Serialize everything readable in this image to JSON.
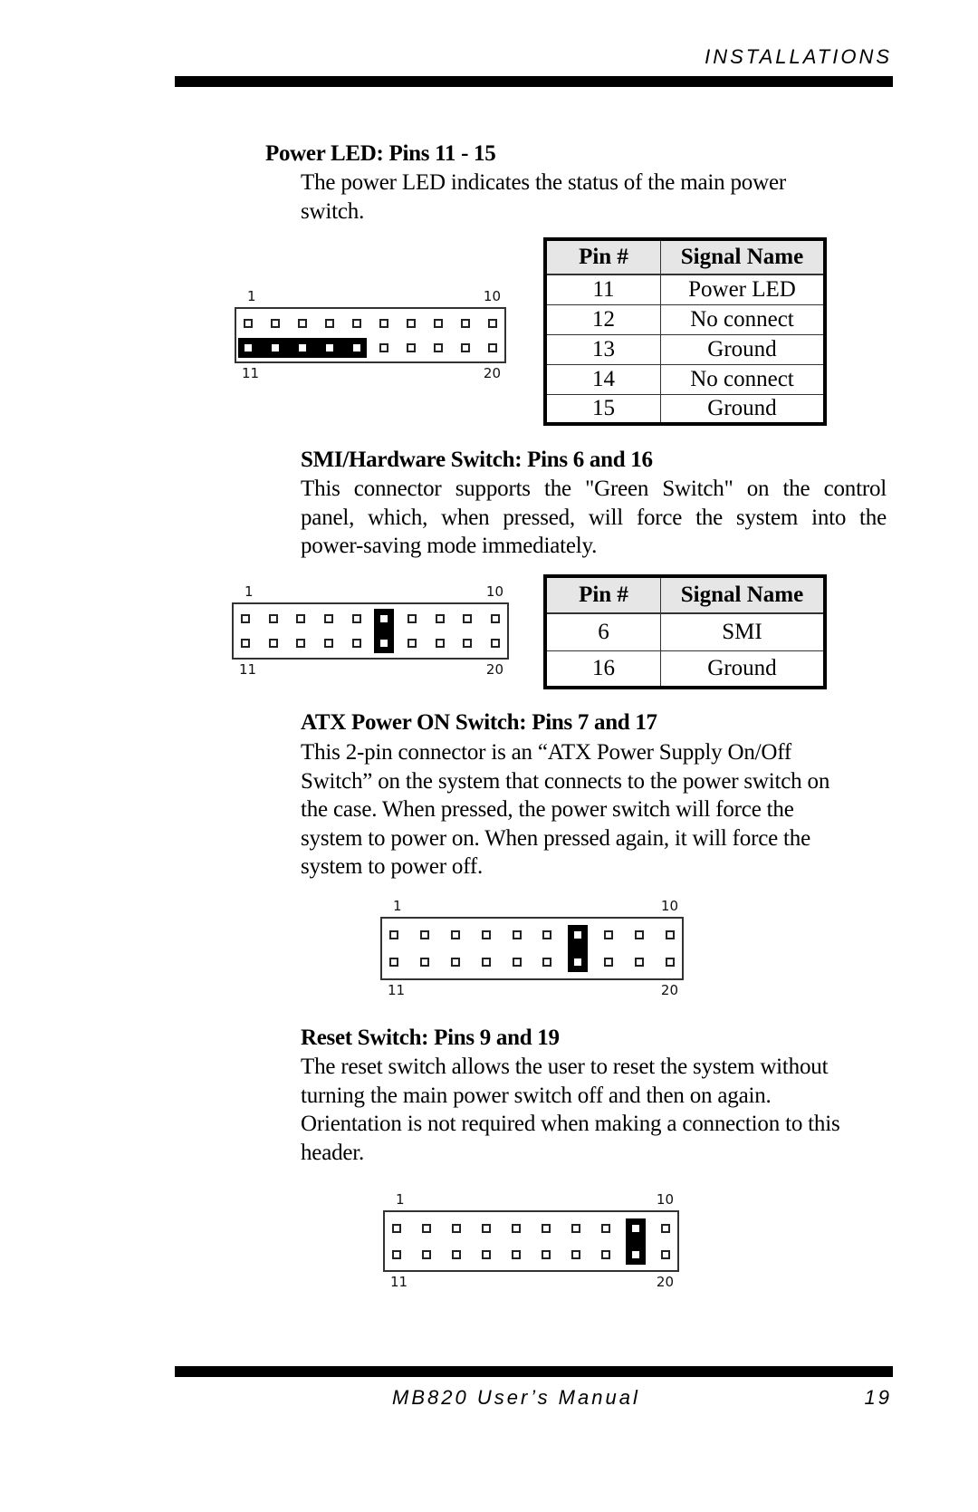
{
  "header": {
    "section": "INSTALLATIONS"
  },
  "footer": {
    "manual": "MB820 User’s Manual",
    "page": "19"
  },
  "sections": [
    {
      "id": "power-led",
      "title": "Power LED: Pins 11 - 15",
      "lines": [
        "The power LED indicates the status of the main power",
        "switch."
      ],
      "header_labels": {
        "top_left": "1",
        "top_right": "10",
        "bottom_left": "11",
        "bottom_right": "20"
      },
      "highlighted_pins": [
        11,
        12,
        13,
        14,
        15
      ],
      "table": {
        "columns": [
          "Pin #",
          "Signal Name"
        ],
        "rows": [
          [
            "11",
            "Power LED"
          ],
          [
            "12",
            "No connect"
          ],
          [
            "13",
            "Ground"
          ],
          [
            "14",
            "No connect"
          ],
          [
            "15",
            "Ground"
          ]
        ]
      }
    },
    {
      "id": "smi-switch",
      "title": "SMI/Hardware Switch: Pins 6 and 16",
      "lines": [
        "This connector supports the \"Green Switch\" on the control",
        "panel, which, when pressed, will force the system into the",
        "power-saving mode immediately."
      ],
      "header_labels": {
        "top_left": "1",
        "top_right": "10",
        "bottom_left": "11",
        "bottom_right": "20"
      },
      "highlighted_pins": [
        6,
        16
      ],
      "table": {
        "columns": [
          "Pin #",
          "Signal Name"
        ],
        "rows": [
          [
            "6",
            "SMI"
          ],
          [
            "16",
            "Ground"
          ]
        ]
      }
    },
    {
      "id": "atx-power-switch",
      "title": "ATX Power ON Switch: Pins 7 and 17",
      "lines": [
        "This 2-pin connector is an “ATX Power Supply On/Off",
        "Switch” on the system that connects to the power switch on",
        "the case. When pressed, the power switch will force the",
        "system to power on. When pressed again, it will force the",
        "system to power off."
      ],
      "header_labels": {
        "top_left": "1",
        "top_right": "10",
        "bottom_left": "11",
        "bottom_right": "20"
      },
      "highlighted_pins": [
        7,
        17
      ]
    },
    {
      "id": "reset-switch",
      "title": "Reset Switch: Pins 9 and 19",
      "lines": [
        "The reset switch allows the user to reset the system without",
        "turning the main power switch off and then on again.",
        "Orientation is not required when making a connection to this",
        "header."
      ],
      "header_labels": {
        "top_left": "1",
        "top_right": "10",
        "bottom_left": "11",
        "bottom_right": "20"
      },
      "highlighted_pins": [
        9,
        19
      ]
    }
  ]
}
